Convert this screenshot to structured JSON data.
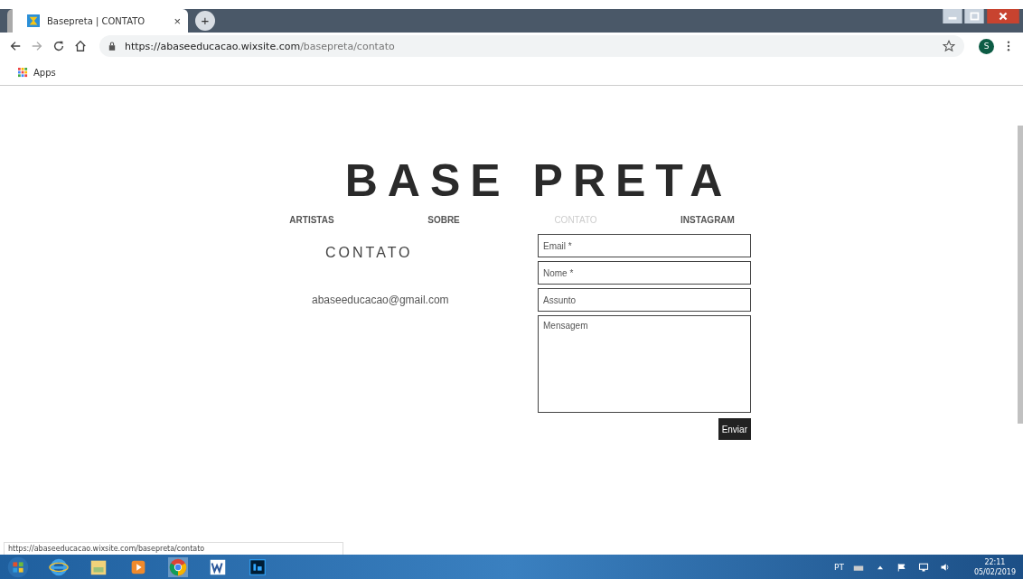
{
  "browser": {
    "tab": {
      "title": "Basepreta | CONTATO",
      "close": "×",
      "new_tab": "+"
    },
    "url": {
      "host": "https://abaseeducacao.wixsite.com",
      "path": "/basepreta/contato"
    },
    "profile": "S",
    "bookmarks": [
      {
        "label": "Apps"
      }
    ]
  },
  "site": {
    "logo": "BASE PRETA",
    "nav": [
      {
        "label": "ARTISTAS",
        "selected": false
      },
      {
        "label": "SOBRE",
        "selected": false
      },
      {
        "label": "CONTATO",
        "selected": true
      },
      {
        "label": "INSTAGRAM",
        "selected": false
      }
    ],
    "heading": "CONTATO",
    "email": "abaseeducacao@gmail.com",
    "form": {
      "fields": [
        {
          "placeholder": "Email *",
          "kind": "input"
        },
        {
          "placeholder": "Nome *",
          "kind": "input"
        },
        {
          "placeholder": "Assunto",
          "kind": "input"
        },
        {
          "placeholder": "Mensagem",
          "kind": "textarea"
        }
      ],
      "submit": "Enviar"
    }
  },
  "status_url": "https://abaseeducacao.wixsite.com/basepreta/contato",
  "taskbar": {
    "language": "PT",
    "time": "22:11",
    "date": "05/02/2019"
  }
}
